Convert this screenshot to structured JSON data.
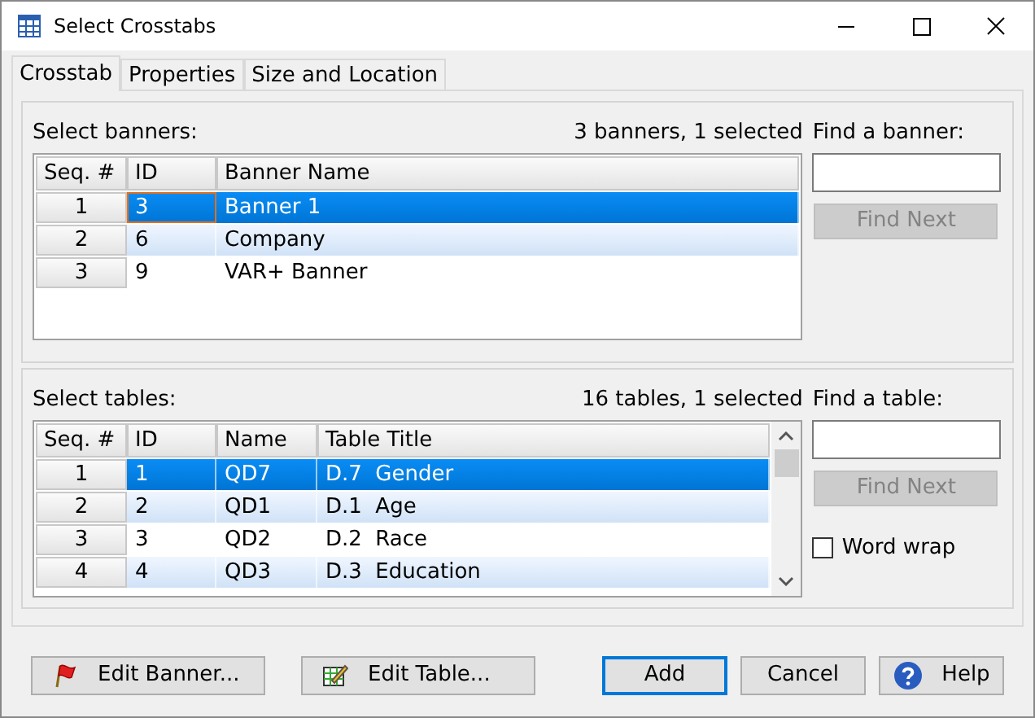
{
  "window": {
    "title": "Select Crosstabs"
  },
  "tabs": [
    {
      "label": "Crosstab",
      "selected": true
    },
    {
      "label": "Properties",
      "selected": false
    },
    {
      "label": "Size and Location",
      "selected": false
    }
  ],
  "banners": {
    "label": "Select banners:",
    "summary": "3 banners, 1 selected",
    "find_label": "Find a banner:",
    "find_button": {
      "label": "Find Next",
      "disabled": true
    },
    "columns": [
      "Seq. #",
      "ID",
      "Banner Name"
    ],
    "rows": [
      {
        "cells": [
          "1",
          "3",
          "Banner 1"
        ],
        "selected": true
      },
      {
        "cells": [
          "2",
          "6",
          "Company"
        ],
        "selected": false
      },
      {
        "cells": [
          "3",
          "9",
          "VAR+ Banner"
        ],
        "selected": false
      }
    ]
  },
  "tables": {
    "label": "Select tables:",
    "summary": "16 tables, 1 selected",
    "find_label": "Find a table:",
    "find_button": {
      "label": "Find Next",
      "disabled": true
    },
    "word_wrap": {
      "label": "Word wrap",
      "checked": false
    },
    "columns": [
      "Seq. #",
      "ID",
      "Name",
      "Table Title"
    ],
    "rows": [
      {
        "cells": [
          "1",
          "1",
          "QD7",
          "D.7  Gender"
        ],
        "selected": true
      },
      {
        "cells": [
          "2",
          "2",
          "QD1",
          "D.1  Age"
        ],
        "selected": false
      },
      {
        "cells": [
          "3",
          "3",
          "QD2",
          "D.2  Race"
        ],
        "selected": false
      },
      {
        "cells": [
          "4",
          "4",
          "QD3",
          "D.3  Education"
        ],
        "selected": false
      }
    ]
  },
  "buttons": [
    {
      "kind": "banner",
      "label": "Edit Banner..."
    },
    {
      "kind": "table",
      "label": "Edit Table..."
    },
    {
      "kind": "default",
      "label": "Add"
    },
    {
      "kind": "plain",
      "label": "Cancel"
    },
    {
      "kind": "help",
      "label": "Help"
    }
  ]
}
